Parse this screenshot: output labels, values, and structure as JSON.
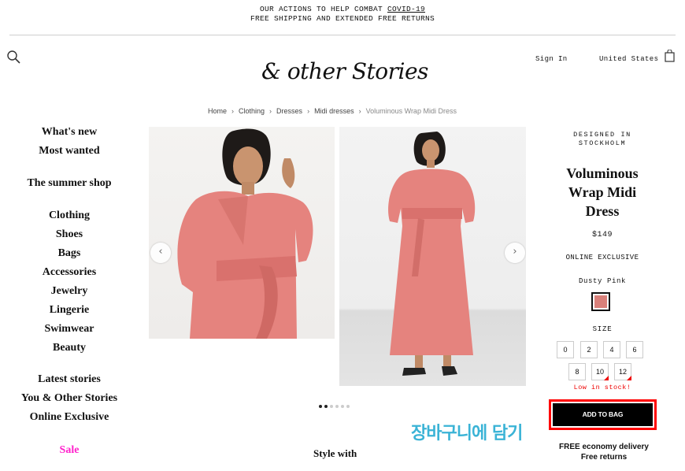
{
  "banner": {
    "line1_prefix": "OUR ACTIONS TO HELP COMBAT ",
    "line1_link": "COVID-19",
    "line2": "FREE SHIPPING AND EXTENDED FREE RETURNS"
  },
  "header": {
    "logo": "& other Stories",
    "sign_in": "Sign In",
    "country": "United States",
    "icons": {
      "search": "search-icon",
      "bag": "shopping-bag-icon"
    }
  },
  "breadcrumb": [
    "Home",
    "Clothing",
    "Dresses",
    "Midi dresses",
    "Voluminous Wrap Midi Dress"
  ],
  "nav": {
    "group1": [
      "What's new",
      "Most wanted"
    ],
    "group2": [
      "The summer shop"
    ],
    "group3": [
      "Clothing",
      "Shoes",
      "Bags",
      "Accessories",
      "Jewelry",
      "Lingerie",
      "Swimwear",
      "Beauty"
    ],
    "group4": [
      "Latest stories",
      "You & Other Stories",
      "Online Exclusive"
    ],
    "sale": "Sale",
    "sale_color": "#ff22cc"
  },
  "gallery": {
    "prev_icon": "chevron-left-icon",
    "next_icon": "chevron-right-icon",
    "dot_count": 6,
    "active_dot": 1
  },
  "style_with": "Style with",
  "product": {
    "designed_line1": "DESIGNED IN",
    "designed_line2": "STOCKHOLM",
    "title": "Voluminous Wrap Midi Dress",
    "price": "$149",
    "exclusive": "ONLINE EXCLUSIVE",
    "color_name": "Dusty Pink",
    "color_hex": "#d9807a",
    "size_label": "SIZE",
    "sizes": [
      {
        "label": "0",
        "low_stock": false
      },
      {
        "label": "2",
        "low_stock": false
      },
      {
        "label": "4",
        "low_stock": false
      },
      {
        "label": "6",
        "low_stock": false
      },
      {
        "label": "8",
        "low_stock": false
      },
      {
        "label": "10",
        "low_stock": true
      },
      {
        "label": "12",
        "low_stock": true
      }
    ],
    "low_stock_text": "Low in stock!",
    "add_to_bag": "ADD TO BAG",
    "shipping_line1": "FREE economy delivery",
    "shipping_line2": "Free returns"
  },
  "annotation": {
    "text": "장바구니에 담기",
    "highlight_color": "#ff0000",
    "text_color": "#3ab3d6"
  }
}
